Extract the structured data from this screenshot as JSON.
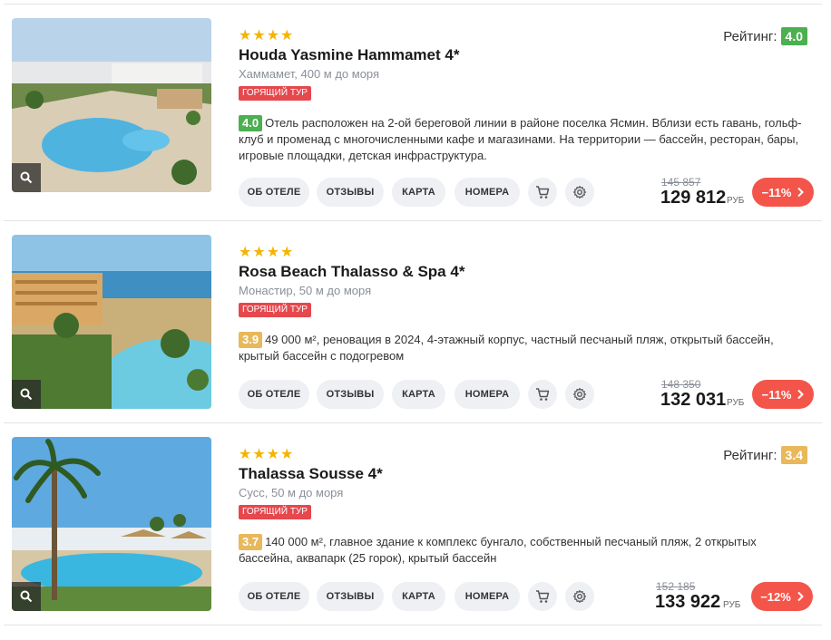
{
  "hotels": [
    {
      "stars": "★★★★",
      "name": "Houda Yasmine Hammamet 4*",
      "location": "Хаммамет, 400 м до моря",
      "hot_badge": "ГОРЯЩИЙ ТУР",
      "rating_label": "Рейтинг:",
      "rating_value": "4.0",
      "rating_color": "#4caf50",
      "desc_score": "4.0",
      "description": "Отель расположен на 2-ой береговой линии в районе поселка Ясмин. Вблизи есть гавань, гольф-клуб и променад с многочисленными кафе и магазинами. На территории — бассейн, ресторан, бары, игровые площадки, детская инфраструктура.",
      "buttons": [
        "ОБ ОТЕЛЕ",
        "ОТЗЫВЫ",
        "КАРТА",
        "НОМЕРА"
      ],
      "old_price": "145 857",
      "price": "129 812",
      "currency": "РУБ",
      "discount": "−11%"
    },
    {
      "stars": "★★★★",
      "name": "Rosa Beach Thalasso & Spa 4*",
      "location": "Монастир, 50 м до моря",
      "hot_badge": "ГОРЯЩИЙ ТУР",
      "desc_score": "3.9",
      "description": "49 000 м², реновация в 2024, 4-этажный корпус, частный песчаный пляж, открытый бассейн, крытый бассейн с подогревом",
      "buttons": [
        "ОБ ОТЕЛЕ",
        "ОТЗЫВЫ",
        "КАРТА",
        "НОМЕРА"
      ],
      "old_price": "148 350",
      "price": "132 031",
      "currency": "РУБ",
      "discount": "−11%"
    },
    {
      "stars": "★★★★",
      "name": "Thalassa Sousse 4*",
      "location": "Сусс, 50 м до моря",
      "hot_badge": "ГОРЯЩИЙ ТУР",
      "rating_label": "Рейтинг:",
      "rating_value": "3.4",
      "rating_color": "#e8b85a",
      "desc_score": "3.7",
      "description": "140 000 м², главное здание к комплекс бунгало, собственный песчаный пляж, 2 открытых бассейна, аквапарк (25 горок), крытый бассейн",
      "buttons": [
        "ОБ ОТЕЛЕ",
        "ОТЗЫВЫ",
        "КАРТА",
        "НОМЕРА"
      ],
      "old_price": "152 185",
      "price": "133 922",
      "currency": "РУБ",
      "discount": "−12%"
    }
  ],
  "colors": {
    "accent": "#f4554a",
    "hot": "#e5484d",
    "star": "#f4b400",
    "score_green": "#4caf50",
    "score_yellow": "#e8b85a"
  }
}
